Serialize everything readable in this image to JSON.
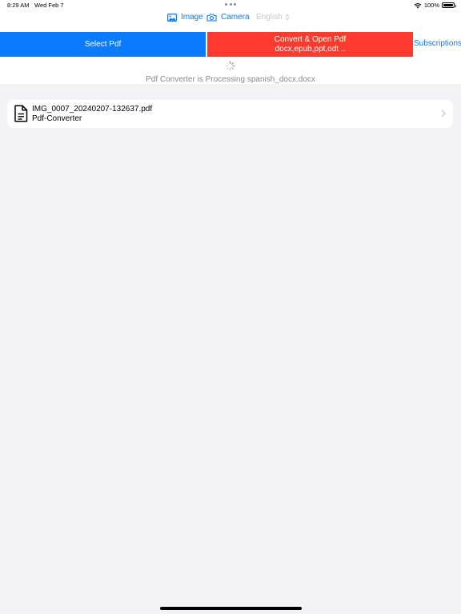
{
  "status_bar": {
    "time": "8:29 AM",
    "date": "Wed Feb 7",
    "battery": "100%",
    "icons": [
      "wifi-icon",
      "battery-icon"
    ]
  },
  "toolbar": {
    "image_label": "Image",
    "camera_label": "Camera",
    "language_label": "English"
  },
  "actions": {
    "select_pdf": "Select Pdf",
    "convert_title": "Convert & Open Pdf",
    "convert_subtitle": "docx,epub,ppt,odt ..",
    "subscriptions": "Subscriptions"
  },
  "processing_text": "Pdf Converter is Processing spanish_docx.docx",
  "files": [
    {
      "name": "IMG_0007_20240207-132637.pdf",
      "folder": "Pdf-Converter"
    }
  ],
  "colors": {
    "accent_blue": "#0a7aff",
    "accent_red": "#ff3b30",
    "background": "#f2f2f7"
  }
}
